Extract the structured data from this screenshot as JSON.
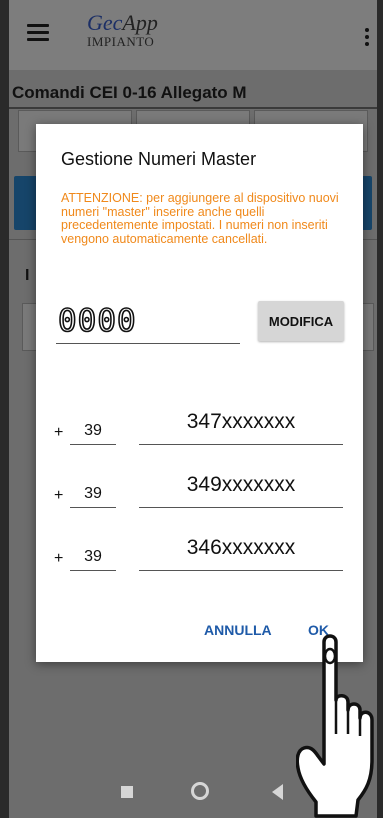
{
  "app": {
    "brand_title": "Gec",
    "brand_title_suffix": "App",
    "brand_subtitle": "IMPIANTO"
  },
  "background": {
    "page_title": "Comandi CEI 0-16 Allegato M",
    "partial_letter": "I"
  },
  "dialog": {
    "title": "Gestione Numeri Master",
    "warning": "ATTENZIONE: per aggiungere al dispositivo nuovi numeri \"master\" inserire anche quelli precedentemente impostati. I numeri non inseriti vengono automaticamente cancellati.",
    "code_value": "0000",
    "modify_label": "MODIFICA",
    "plus_sign": "+",
    "numbers": [
      {
        "prefix": "39",
        "number": "347xxxxxxx"
      },
      {
        "prefix": "39",
        "number": "349xxxxxxx"
      },
      {
        "prefix": "39",
        "number": "346xxxxxxx"
      }
    ],
    "cancel_label": "ANNULLA",
    "ok_label": "OK"
  },
  "colors": {
    "warning": "#f0891b",
    "button_text": "#1e5aa8",
    "brand": "#1c2f66"
  },
  "icons": [
    "menu-icon",
    "overflow-menu-icon",
    "nav-back-icon",
    "nav-home-icon",
    "nav-recent-icon",
    "hand-pointer-icon"
  ]
}
